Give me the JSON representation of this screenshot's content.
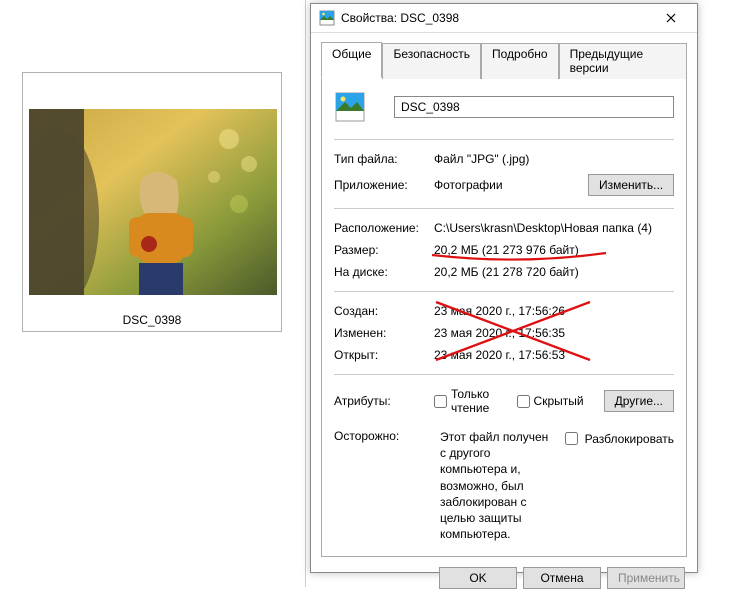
{
  "explorer": {
    "thumbnail_caption": "DSC_0398"
  },
  "dialog": {
    "title": "Свойства: DSC_0398",
    "tabs": {
      "general": "Общие",
      "security": "Безопасность",
      "details": "Подробно",
      "previous": "Предыдущие версии"
    },
    "filename": "DSC_0398",
    "rows": {
      "filetype_label": "Тип файла:",
      "filetype_value": "Файл \"JPG\" (.jpg)",
      "app_label": "Приложение:",
      "app_value": "Фотографии",
      "change_btn": "Изменить...",
      "location_label": "Расположение:",
      "location_value": "C:\\Users\\krasn\\Desktop\\Новая папка (4)",
      "size_label": "Размер:",
      "size_value": "20,2 МБ (21 273 976 байт)",
      "ondisk_label": "На диске:",
      "ondisk_value": "20,2 МБ (21 278 720 байт)",
      "created_label": "Создан:",
      "created_value": "23 мая 2020 г., 17:56:26",
      "modified_label": "Изменен:",
      "modified_value": "23 мая 2020 г., 17:56:35",
      "accessed_label": "Открыт:",
      "accessed_value": "23 мая 2020 г., 17:56:53",
      "attributes_label": "Атрибуты:",
      "readonly_label": "Только чтение",
      "hidden_label": "Скрытый",
      "other_btn": "Другие...",
      "caution_label": "Осторожно:",
      "caution_text": "Этот файл получен с другого компьютера и, возможно, был заблокирован с целью защиты компьютера.",
      "unblock_label": "Разблокировать"
    },
    "footer": {
      "ok": "OK",
      "cancel": "Отмена",
      "apply": "Применить"
    }
  }
}
